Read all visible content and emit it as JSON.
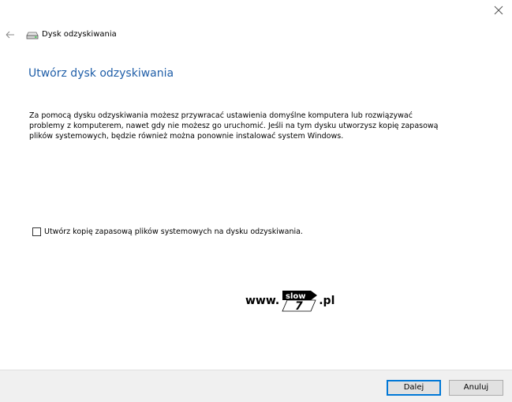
{
  "window": {
    "nav_title": "Dysk odzyskiwania"
  },
  "icons": {
    "close": "close-icon",
    "back": "back-arrow-icon",
    "drive": "drive-icon"
  },
  "main": {
    "heading": "Utwórz dysk odzyskiwania",
    "description": "Za pomocą dysku odzyskiwania możesz przywracać ustawienia domyślne komputera lub rozwiązywać problemy z komputerem, nawet gdy nie możesz go uruchomić. Jeśli na tym dysku utworzysz kopię zapasową plików systemowych, będzie również można ponownie instalować system Windows.",
    "checkbox_label": "Utwórz kopię zapasową plików systemowych na dysku odzyskiwania.",
    "checkbox_checked": false
  },
  "watermark": {
    "prefix": "www.",
    "logo_text_top": "slow",
    "logo_text_bottom": "7",
    "suffix": ".pl"
  },
  "footer": {
    "next_label": "Dalej",
    "cancel_label": "Anuluj"
  },
  "colors": {
    "heading": "#1f5ea8",
    "accent_border": "#0078d7",
    "footer_bg": "#f0f0f0"
  }
}
